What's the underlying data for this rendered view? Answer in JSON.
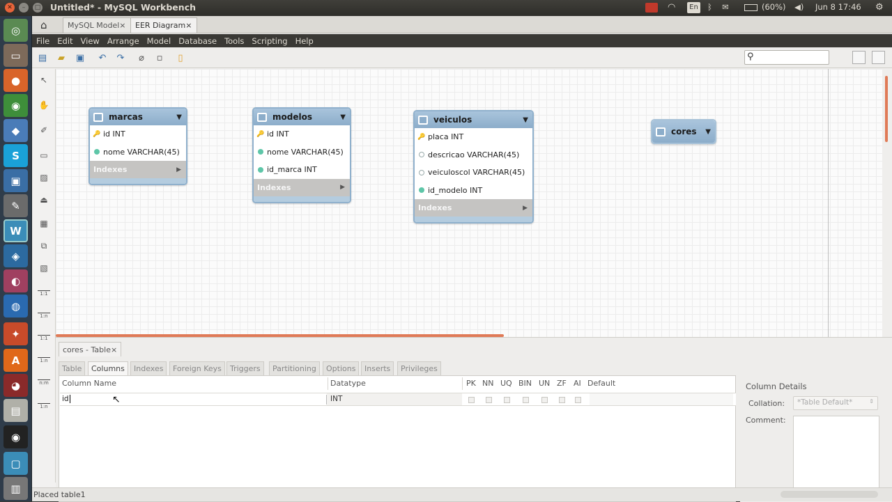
{
  "window": {
    "title": "Untitled* - MySQL Workbench"
  },
  "tray": {
    "battery": "(60%)",
    "keyboard": "En",
    "datetime": "Jun 8 17:46"
  },
  "doc_tabs": [
    {
      "label": "MySQL Model",
      "close": "×"
    },
    {
      "label": "EER Diagram",
      "close": "×"
    }
  ],
  "menu": [
    "File",
    "Edit",
    "View",
    "Arrange",
    "Model",
    "Database",
    "Tools",
    "Scripting",
    "Help"
  ],
  "tables": [
    {
      "name": "marcas",
      "columns": [
        {
          "text": "id INT",
          "kind": "pk"
        },
        {
          "text": "nome VARCHAR(45)",
          "kind": "filled"
        }
      ],
      "indexes": "Indexes"
    },
    {
      "name": "modelos",
      "columns": [
        {
          "text": "id INT",
          "kind": "pk"
        },
        {
          "text": "nome VARCHAR(45)",
          "kind": "filled"
        },
        {
          "text": "id_marca INT",
          "kind": "filled"
        }
      ],
      "indexes": "Indexes"
    },
    {
      "name": "veiculos",
      "columns": [
        {
          "text": "placa INT",
          "kind": "pk"
        },
        {
          "text": "descricao VARCHAR(45)",
          "kind": "hollow"
        },
        {
          "text": "veiculoscol VARCHAR(45)",
          "kind": "hollow"
        },
        {
          "text": "id_modelo INT",
          "kind": "filled"
        }
      ],
      "indexes": "Indexes"
    },
    {
      "name": "cores",
      "columns": [],
      "indexes": ""
    }
  ],
  "palette_labels": [
    "1:1",
    "1:n",
    "1:1",
    "1:n",
    "n:m",
    "1:n"
  ],
  "editor": {
    "tab_label": "cores - Table",
    "close": "×",
    "subtabs": [
      "Table",
      "Columns",
      "Indexes",
      "Foreign Keys",
      "Triggers",
      "Partitioning",
      "Options",
      "Inserts",
      "Privileges"
    ],
    "active_subtab": "Columns",
    "headers": {
      "column_name": "Column Name",
      "datatype": "Datatype",
      "pk": "PK",
      "nn": "NN",
      "uq": "UQ",
      "bin": "BIN",
      "un": "UN",
      "zf": "ZF",
      "ai": "AI",
      "default": "Default"
    },
    "row": {
      "column_name": "id",
      "datatype": "INT"
    },
    "details": {
      "title": "Column Details",
      "collation_label": "Collation:",
      "collation_value": "*Table Default*",
      "comment_label": "Comment:"
    }
  },
  "status": {
    "text": "Placed table1"
  },
  "colors": {
    "accent": "#e07a56",
    "table_header": "#8cadca",
    "launcher": "#2f3c4a"
  }
}
